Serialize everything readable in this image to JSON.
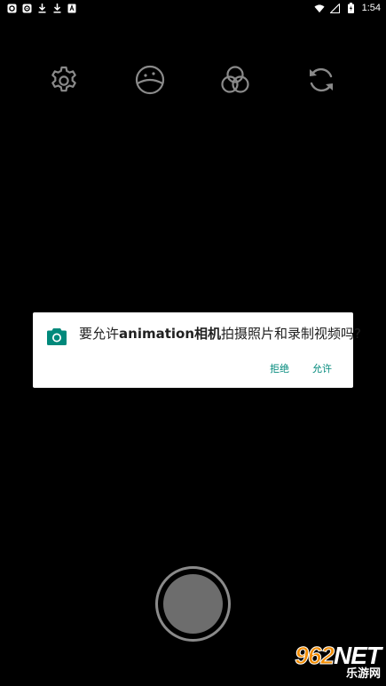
{
  "status_bar": {
    "time": "1:54",
    "left_icons": [
      "notification-o-icon",
      "notification-circle-icon",
      "download-icon",
      "download-icon",
      "notification-a-icon"
    ],
    "right_icons": [
      "wifi-icon",
      "signal-icon",
      "battery-icon"
    ]
  },
  "toolbar": {
    "items": [
      {
        "name": "settings",
        "icon": "gear-icon"
      },
      {
        "name": "exposure",
        "icon": "exposure-icon"
      },
      {
        "name": "filters",
        "icon": "filters-icon"
      },
      {
        "name": "switch-camera",
        "icon": "switch-camera-icon"
      }
    ]
  },
  "dialog": {
    "message_prefix": "要允许",
    "app_name": "animation相机",
    "message_suffix": "拍摄照片和录制视频吗?",
    "deny_label": "拒绝",
    "allow_label": "允许",
    "icon": "camera-icon",
    "accent_color": "#00897b"
  },
  "watermark": {
    "digits": "962",
    "suffix": "NET",
    "subtitle": "乐游网"
  },
  "colors": {
    "background": "#000000",
    "toolbar_icon": "#8a8a8a",
    "shutter_ring": "#8a8a8a",
    "shutter_fill": "#6d6d6d"
  }
}
